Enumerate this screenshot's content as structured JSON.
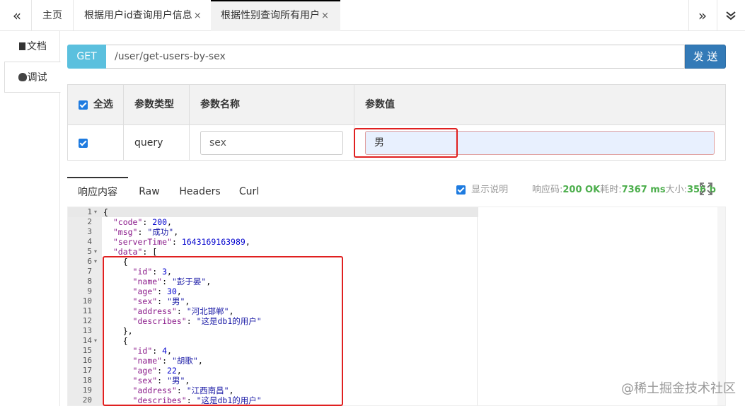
{
  "tabbar": {
    "back_icon": "«",
    "tabs": [
      {
        "label": "主页"
      },
      {
        "label": "根据用户id查询用户信息",
        "close": "×"
      },
      {
        "label": "根据性别查询所有用户",
        "close": "×",
        "active": true
      }
    ],
    "forward_icon": "»",
    "collapse_icon": "⌄"
  },
  "sidebar": {
    "items": [
      {
        "label": "文档",
        "icon": "document-icon"
      },
      {
        "label": "调试",
        "icon": "bug-icon",
        "active": true
      }
    ]
  },
  "request": {
    "method": "GET",
    "url": "/user/get-users-by-sex",
    "send_label": "发 送"
  },
  "params": {
    "headers": {
      "select_all": "全选",
      "type": "参数类型",
      "name": "参数名称",
      "value": "参数值"
    },
    "rows": [
      {
        "checked": true,
        "type": "query",
        "name": "sex",
        "value": "男"
      }
    ]
  },
  "response": {
    "tabs": [
      "响应内容",
      "Raw",
      "Headers",
      "Curl"
    ],
    "active_tab": "响应内容",
    "show_desc_label": "显示说明",
    "status_prefix": "响应码:",
    "status_code": "200 OK",
    "time_prefix": "耗时:",
    "time_value": "7367 ms",
    "size_prefix": "大小:",
    "size_value": "356 b",
    "lines": [
      "{",
      "  \"code\": 200,",
      "  \"msg\": \"成功\",",
      "  \"serverTime\": 1643169163989,",
      "  \"data\": [",
      "    {",
      "      \"id\": 3,",
      "      \"name\": \"彭于晏\",",
      "      \"age\": 30,",
      "      \"sex\": \"男\",",
      "      \"address\": \"河北邯郸\",",
      "      \"describes\": \"这是db1的用户\"",
      "    },",
      "    {",
      "      \"id\": 4,",
      "      \"name\": \"胡歌\",",
      "      \"age\": 22,",
      "      \"sex\": \"男\",",
      "      \"address\": \"江西南昌\",",
      "      \"describes\": \"这是db1的用户\""
    ],
    "fold_lines": [
      1,
      5,
      6,
      14
    ]
  },
  "watermark": "@稀土掘金技术社区",
  "colors": {
    "accent": "#337ab7",
    "method": "#5bc0de",
    "ok": "#4cae4c",
    "highlight": "#e02020"
  }
}
